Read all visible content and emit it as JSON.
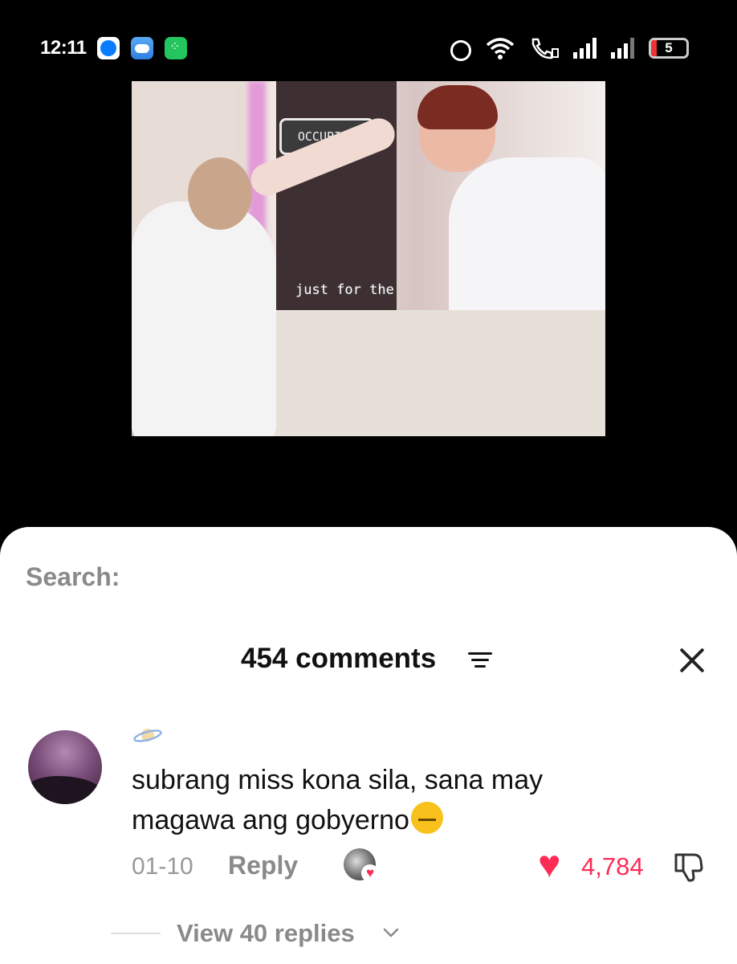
{
  "status_bar": {
    "time": "12:11",
    "battery": "5",
    "icons": [
      "messenger-icon",
      "weather-icon",
      "green-app-icon",
      "alarm-icon",
      "wifi-icon",
      "wifi-call-icon",
      "signal-icon",
      "signal-icon",
      "battery-icon"
    ]
  },
  "video": {
    "sign_text": "OCCUPIED",
    "caption": "just for the"
  },
  "search": {
    "label": "Search:"
  },
  "comments": {
    "count_label": "454 comments",
    "items": [
      {
        "text": "subrang miss kona sila, sana may magawa ang gobyerno",
        "date": "01-10",
        "reply_label": "Reply",
        "likes": "4,784",
        "view_replies": "View 40 replies"
      }
    ]
  },
  "colors": {
    "accent": "#fe2c55",
    "muted": "#8a8a8a"
  }
}
